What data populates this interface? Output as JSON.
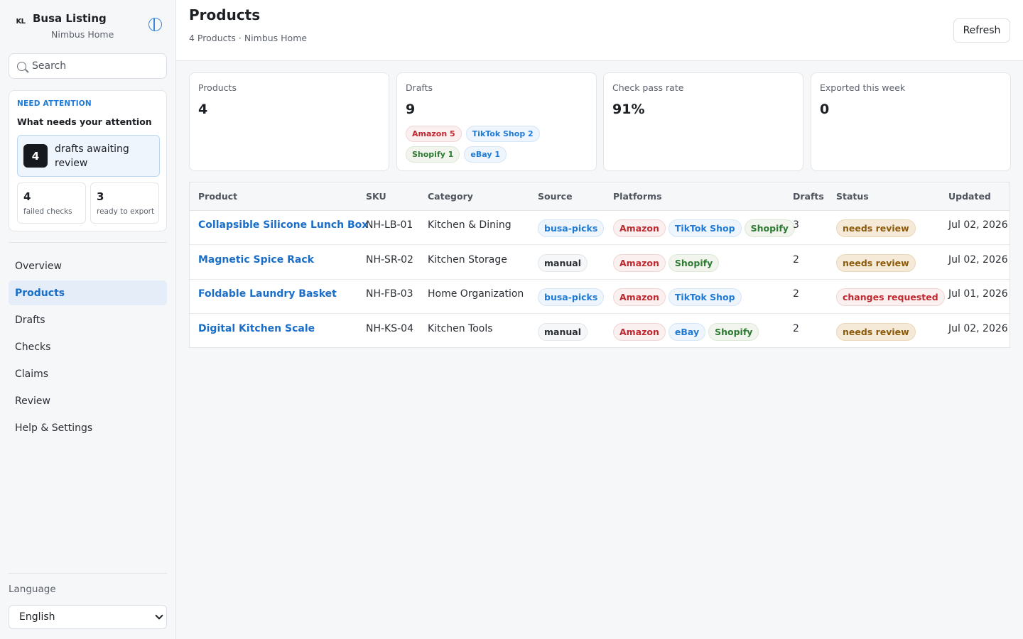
{
  "brand": {
    "logo": "KL",
    "name": "Busa Listing",
    "sub": "Nimbus Home"
  },
  "search": {
    "placeholder": "Search"
  },
  "attention": {
    "eyebrow": "NEED ATTENTION",
    "title": "What needs your attention",
    "main": {
      "count": "4",
      "label": "drafts awaiting review"
    },
    "mini": [
      {
        "count": "4",
        "label": "failed checks"
      },
      {
        "count": "3",
        "label": "ready to export"
      }
    ]
  },
  "nav": {
    "items": [
      {
        "label": "Overview"
      },
      {
        "label": "Products",
        "active": true
      },
      {
        "label": "Drafts"
      },
      {
        "label": "Checks"
      },
      {
        "label": "Claims"
      },
      {
        "label": "Review"
      },
      {
        "label": "Help & Settings"
      }
    ]
  },
  "language": {
    "label": "Language",
    "value": "English"
  },
  "header": {
    "title": "Products",
    "sub": "4 Products · Nimbus Home",
    "refresh": "Refresh"
  },
  "stats": [
    {
      "label": "Products",
      "value": "4"
    },
    {
      "label": "Drafts",
      "value": "9",
      "chips": [
        {
          "text": "Amazon 5",
          "kind": "amazon"
        },
        {
          "text": "TikTok Shop 2",
          "kind": "tiktok"
        },
        {
          "text": "Shopify 1",
          "kind": "shopify"
        },
        {
          "text": "eBay 1",
          "kind": "ebay"
        }
      ]
    },
    {
      "label": "Check pass rate",
      "value": "91%"
    },
    {
      "label": "Exported this week",
      "value": "0"
    }
  ],
  "table": {
    "headers": [
      "Product",
      "SKU",
      "Category",
      "Source",
      "Platforms",
      "Drafts",
      "Status",
      "Updated"
    ],
    "rows": [
      {
        "product": "Collapsible Silicone Lunch Box",
        "sku": "NH-LB-01",
        "category": "Kitchen & Dining",
        "source": {
          "text": "busa-picks",
          "kind": "busa"
        },
        "platforms": [
          {
            "text": "Amazon",
            "kind": "amazon"
          },
          {
            "text": "TikTok Shop",
            "kind": "tiktok"
          },
          {
            "text": "Shopify",
            "kind": "shopify"
          }
        ],
        "drafts": "3",
        "status": {
          "text": "needs review",
          "kind": "review"
        },
        "updated": "Jul 02, 2026"
      },
      {
        "product": "Magnetic Spice Rack",
        "sku": "NH-SR-02",
        "category": "Kitchen Storage",
        "source": {
          "text": "manual",
          "kind": "manual"
        },
        "platforms": [
          {
            "text": "Amazon",
            "kind": "amazon"
          },
          {
            "text": "Shopify",
            "kind": "shopify"
          }
        ],
        "drafts": "2",
        "status": {
          "text": "needs review",
          "kind": "review"
        },
        "updated": "Jul 02, 2026"
      },
      {
        "product": "Foldable Laundry Basket",
        "sku": "NH-FB-03",
        "category": "Home Organization",
        "source": {
          "text": "busa-picks",
          "kind": "busa"
        },
        "platforms": [
          {
            "text": "Amazon",
            "kind": "amazon"
          },
          {
            "text": "TikTok Shop",
            "kind": "tiktok"
          }
        ],
        "drafts": "2",
        "status": {
          "text": "changes requested",
          "kind": "changes"
        },
        "updated": "Jul 01, 2026"
      },
      {
        "product": "Digital Kitchen Scale",
        "sku": "NH-KS-04",
        "category": "Kitchen Tools",
        "source": {
          "text": "manual",
          "kind": "manual"
        },
        "platforms": [
          {
            "text": "Amazon",
            "kind": "amazon"
          },
          {
            "text": "eBay",
            "kind": "ebay"
          },
          {
            "text": "Shopify",
            "kind": "shopify"
          }
        ],
        "drafts": "2",
        "status": {
          "text": "needs review",
          "kind": "review"
        },
        "updated": "Jul 02, 2026"
      }
    ]
  }
}
